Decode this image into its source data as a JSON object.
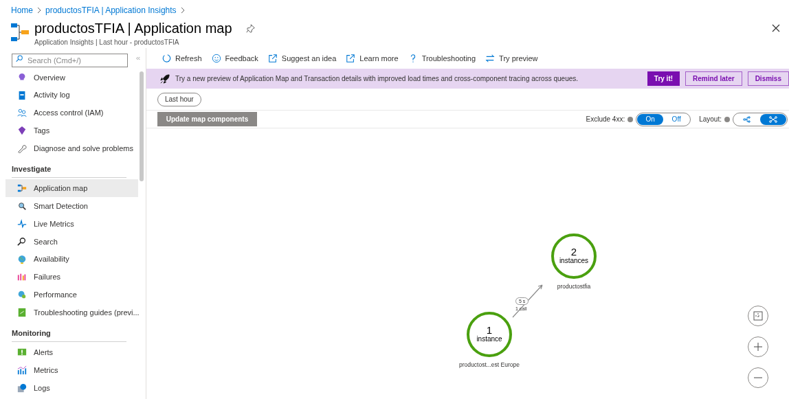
{
  "breadcrumb": [
    "Home",
    "productosTFIA | Application Insights"
  ],
  "title": "productosTFIA | Application map",
  "subtitle": "Application Insights | Last hour - productosTFIA",
  "sidebar": {
    "search": {
      "placeholder": "Search (Cmd+/)"
    },
    "sections": [
      {
        "items": [
          {
            "label": "Overview",
            "selected": false
          },
          {
            "label": "Activity log",
            "selected": false
          },
          {
            "label": "Access control (IAM)",
            "selected": false
          },
          {
            "label": "Tags",
            "selected": false
          },
          {
            "label": "Diagnose and solve problems",
            "selected": false
          }
        ]
      },
      {
        "heading": "Investigate",
        "items": [
          {
            "label": "Application map",
            "selected": true
          },
          {
            "label": "Smart Detection",
            "selected": false
          },
          {
            "label": "Live Metrics",
            "selected": false
          },
          {
            "label": "Search",
            "selected": false
          },
          {
            "label": "Availability",
            "selected": false
          },
          {
            "label": "Failures",
            "selected": false
          },
          {
            "label": "Performance",
            "selected": false
          },
          {
            "label": "Troubleshooting guides (previ...",
            "selected": false
          }
        ]
      },
      {
        "heading": "Monitoring",
        "items": [
          {
            "label": "Alerts",
            "selected": false
          },
          {
            "label": "Metrics",
            "selected": false
          },
          {
            "label": "Logs",
            "selected": false
          }
        ]
      }
    ]
  },
  "toolbar": [
    "Refresh",
    "Feedback",
    "Suggest an idea",
    "Learn more",
    "Troubleshooting",
    "Try preview"
  ],
  "banner": {
    "text": "Try a new preview of Application Map and Transaction details with improved load times and cross-component tracing across queues.",
    "buttons": [
      {
        "label": "Try it!",
        "kind": "primary"
      },
      {
        "label": "Remind later",
        "kind": "outline"
      },
      {
        "label": "Dismiss",
        "kind": "outline"
      }
    ]
  },
  "time_filter": "Last hour",
  "update_button": "Update map components",
  "exclude_4xx": {
    "label": "Exclude 4xx:",
    "options": [
      {
        "label": "On",
        "selected": true
      },
      {
        "label": "Off",
        "selected": false
      }
    ]
  },
  "layout": {
    "label": "Layout:",
    "options": [
      {
        "selected": false
      },
      {
        "selected": true
      }
    ]
  },
  "map": {
    "nodes": [
      {
        "count": "2",
        "unit": "instances",
        "name": "productostfia"
      },
      {
        "count": "1",
        "unit": "instance",
        "name": "productost...est Europe"
      }
    ],
    "edges": [
      {
        "duration": "5 s",
        "calls": "1 call"
      }
    ]
  }
}
